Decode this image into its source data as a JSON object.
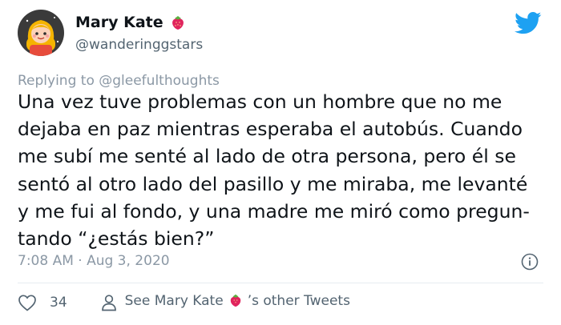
{
  "author": {
    "display_name": "Mary Kate",
    "handle": "@wanderinggstars"
  },
  "reply": {
    "prefix": "Replying to ",
    "to_handle": "@gleefulthoughts"
  },
  "tweet": {
    "lines": [
      "Una vez tuve problemas con un hombre que no me",
      "dejaba en paz mientras esperaba el autobús. Cuando",
      "me subí me senté al lado de otra persona, pero él se",
      "sentó al otro lado del pasillo y me miraba, me levanté",
      "y me fui al fondo, y una madre me miró como pregun-",
      "tando “¿estás bien?”"
    ],
    "timestamp": "7:08 AM · Aug 3, 2020"
  },
  "actions": {
    "like_count": "34",
    "see_more_prefix": "See Mary Kate",
    "see_more_suffix": "’s other Tweets"
  },
  "colors": {
    "brand_twitter": "#1da1f2",
    "text_primary": "#0f1419",
    "text_secondary": "#536471",
    "strawberry": "#e0245e"
  },
  "icons": [
    "avatar-illustration",
    "strawberry-emoji",
    "twitter-bird-icon",
    "info-icon",
    "heart-icon",
    "person-icon"
  ]
}
